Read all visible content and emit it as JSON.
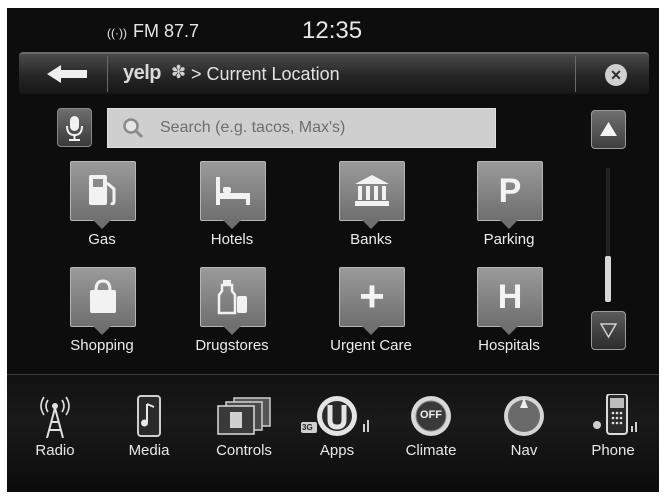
{
  "status": {
    "radio_band": "FM 87.7",
    "time": "12:35"
  },
  "header": {
    "logo": "yelp",
    "breadcrumb": "> Current Location"
  },
  "search": {
    "placeholder": "Search (e.g. tacos, Max's)"
  },
  "categories": [
    {
      "label": "Gas",
      "icon": "gas-pump-icon"
    },
    {
      "label": "Hotels",
      "icon": "bed-icon"
    },
    {
      "label": "Banks",
      "icon": "bank-icon"
    },
    {
      "label": "Parking",
      "icon": "parking-icon",
      "glyph": "P"
    },
    {
      "label": "Shopping",
      "icon": "shopping-bag-icon"
    },
    {
      "label": "Drugstores",
      "icon": "bottles-icon"
    },
    {
      "label": "Urgent Care",
      "icon": "medical-cross-icon",
      "glyph": "+"
    },
    {
      "label": "Hospitals",
      "icon": "hospital-icon",
      "glyph": "H"
    }
  ],
  "dock": [
    {
      "label": "Radio",
      "icon": "radio-tower-icon"
    },
    {
      "label": "Media",
      "icon": "media-player-icon"
    },
    {
      "label": "Controls",
      "icon": "controls-icon"
    },
    {
      "label": "Apps",
      "icon": "apps-icon",
      "badge": "3G"
    },
    {
      "label": "Climate",
      "icon": "climate-icon",
      "knob": "OFF"
    },
    {
      "label": "Nav",
      "icon": "compass-icon"
    },
    {
      "label": "Phone",
      "icon": "phone-icon"
    }
  ],
  "scroll": {
    "position": 0.65
  }
}
